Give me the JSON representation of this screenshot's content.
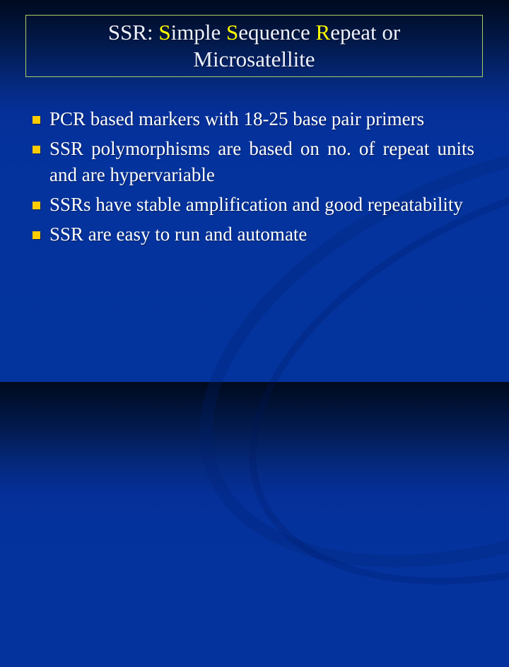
{
  "slide": {
    "title": {
      "parts": [
        {
          "text": "SSR: ",
          "highlight": false
        },
        {
          "text": "S",
          "highlight": true
        },
        {
          "text": "imple ",
          "highlight": false
        },
        {
          "text": "S",
          "highlight": true
        },
        {
          "text": "equence ",
          "highlight": false
        },
        {
          "text": "R",
          "highlight": true
        },
        {
          "text": "epeat or",
          "highlight": false
        }
      ],
      "line2": "Microsatellite"
    },
    "bullets": [
      {
        "text": "PCR based markers with 18-25 base pair primers"
      },
      {
        "text": "SSR polymorphisms are based on no. of repeat units and are hypervariable"
      },
      {
        "text": "SSRs have stable amplification and good repeatability"
      },
      {
        "text": "SSR are easy to run and automate"
      }
    ],
    "colors": {
      "background": "#03339c",
      "highlight": "#ffff00",
      "bullet": "#ffcc00",
      "title_border": "#a8d060"
    }
  }
}
